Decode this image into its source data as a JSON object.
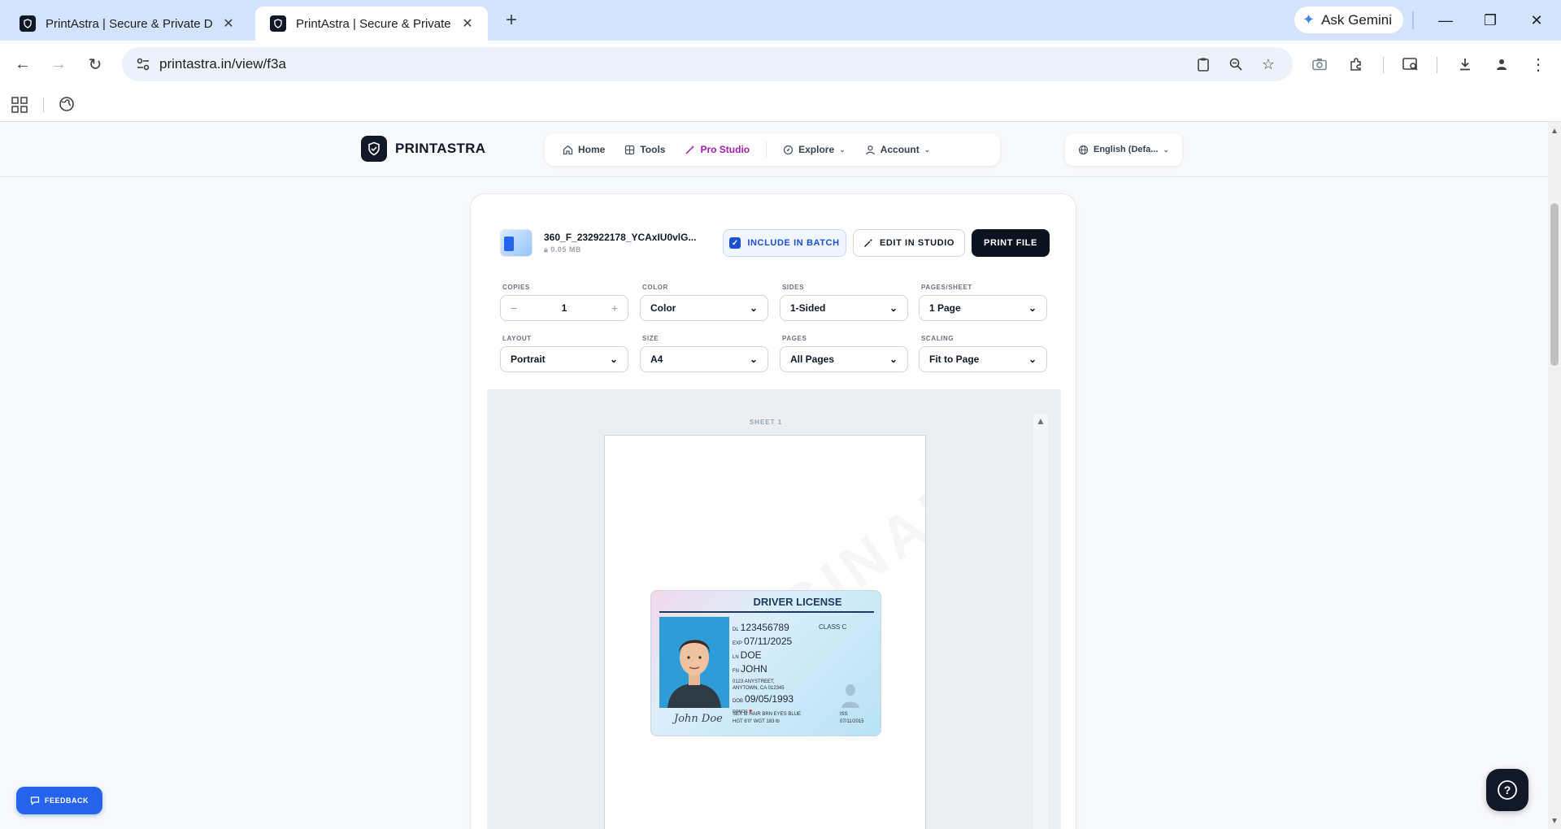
{
  "browser": {
    "tabs": [
      {
        "title": "PrintAstra | Secure & Private Do",
        "active": false
      },
      {
        "title": "PrintAstra | Secure & Private Do",
        "active": true
      }
    ],
    "new_tab_label": "+",
    "gemini_label": "Ask Gemini",
    "url": "printastra.in/view/f3a"
  },
  "site": {
    "brand": "PRINTASTRA",
    "nav": [
      {
        "label": "Home",
        "icon": "home-icon"
      },
      {
        "label": "Tools",
        "icon": "grid-icon"
      },
      {
        "label": "Pro Studio",
        "icon": "wand-icon"
      },
      {
        "label": "Explore",
        "icon": "compass-icon"
      },
      {
        "label": "Account",
        "icon": "user-icon"
      }
    ],
    "language": "English (Defa..."
  },
  "file": {
    "name": "360_F_232922178_YCAxIU0vlG...",
    "size": "0.05 MB",
    "include_batch_label": "INCLUDE IN BATCH",
    "edit_studio_label": "EDIT IN STUDIO",
    "print_label": "PRINT FILE"
  },
  "options": {
    "copies": {
      "label": "COPIES",
      "value": "1"
    },
    "color": {
      "label": "COLOR",
      "value": "Color"
    },
    "sides": {
      "label": "SIDES",
      "value": "1-Sided"
    },
    "pages_per_sheet": {
      "label": "PAGES/SHEET",
      "value": "1 Page"
    },
    "layout": {
      "label": "LAYOUT",
      "value": "Portrait"
    },
    "size": {
      "label": "SIZE",
      "value": "A4"
    },
    "pages": {
      "label": "PAGES",
      "value": "All Pages"
    },
    "scaling": {
      "label": "SCALING",
      "value": "Fit to Page"
    }
  },
  "preview": {
    "sheet_label": "SHEET 1",
    "watermark": "ORIGINAL",
    "license": {
      "title": "DRIVER LICENSE",
      "class": "CLASS C",
      "dl_key": "DL",
      "dl": "123456789",
      "exp_key": "EXP",
      "exp": "07/11/2025",
      "ln_key": "LN",
      "ln": "DOE",
      "fn_key": "FN",
      "fn": "JOHN",
      "address1": "0123 ANYSTREET,",
      "address2": "ANYTOWN, CA 012345",
      "dob_key": "DOB",
      "dob": "09/05/1993",
      "donor": "DONOR",
      "signature": "John Doe",
      "line1": "SEX M    HAIR BRN    EYES BLUE",
      "line2": "HGT 6'0\"    WGT 183 lb",
      "iss_key": "ISS",
      "iss": "07/11/2015"
    }
  },
  "feedback_label": "FEEDBACK",
  "help_label": "?"
}
